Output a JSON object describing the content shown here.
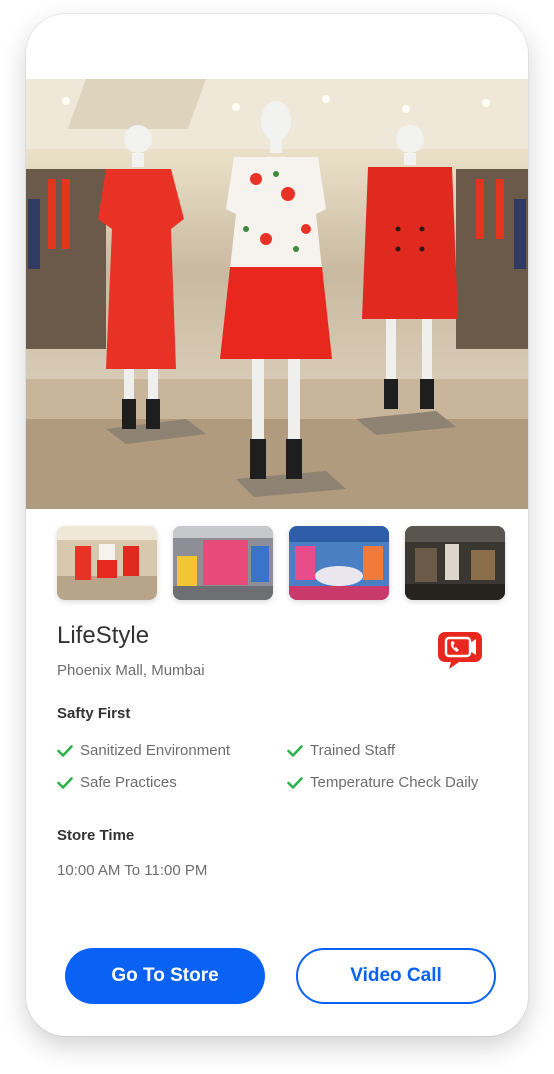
{
  "store": {
    "name": "LifeStyle",
    "location": "Phoenix Mall, Mumbai"
  },
  "safety": {
    "title": "Safty First",
    "items": [
      "Sanitized Environment",
      "Trained Staff",
      "Safe Practices",
      "Temperature Check Daily"
    ]
  },
  "timing": {
    "title": "Store Time",
    "hours": "10:00 AM To 11:00 PM"
  },
  "actions": {
    "go_to_store": "Go To Store",
    "video_call": "Video Call"
  },
  "icons": {
    "check": "check-icon",
    "video_call_badge": "video-call-icon"
  },
  "colors": {
    "accent": "#0a62f5",
    "check": "#2db34a",
    "badge": "#e8271e"
  }
}
